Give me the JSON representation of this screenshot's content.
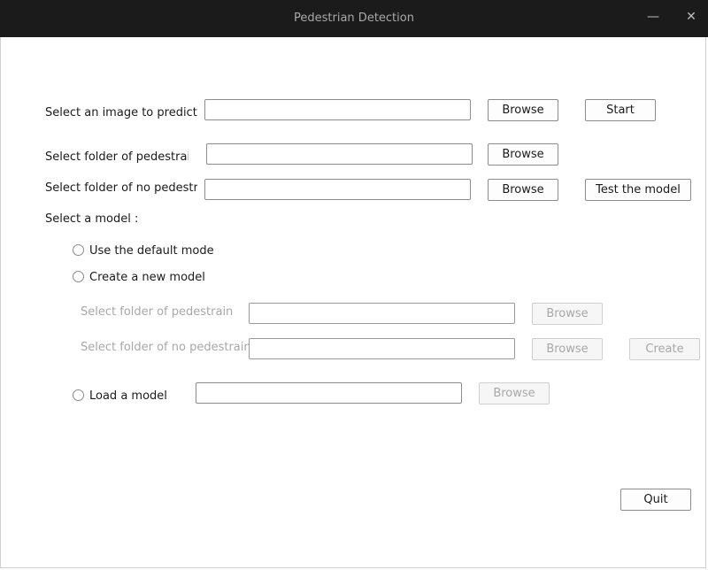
{
  "window": {
    "title": "Pedestrian Detection",
    "minimize_icon": "minimize-icon",
    "close_icon": "close-icon"
  },
  "predict": {
    "label": "Select an image to predict",
    "value": "",
    "browse_label": "Browse",
    "start_label": "Start"
  },
  "test": {
    "pedestrian_label": "Select folder of pedestrain",
    "pedestrian_value": "",
    "pedestrian_browse": "Browse",
    "no_pedestrian_label": "Select folder of no pedestrai",
    "no_pedestrian_value": "",
    "no_pedestrian_browse": "Browse",
    "test_label": "Test the model"
  },
  "model": {
    "heading": "Select a model :",
    "default_option": "Use the default mode",
    "new_option": "Create a new model",
    "new_pedestrian_label": "Select folder of pedestrain",
    "new_pedestrian_browse": "Browse",
    "new_no_pedestrian_label": "Select folder of no pedestrain",
    "new_no_pedestrian_browse": "Browse",
    "create_label": "Create",
    "load_option": "Load a model",
    "load_browse": "Browse"
  },
  "footer": {
    "quit_label": "Quit"
  }
}
